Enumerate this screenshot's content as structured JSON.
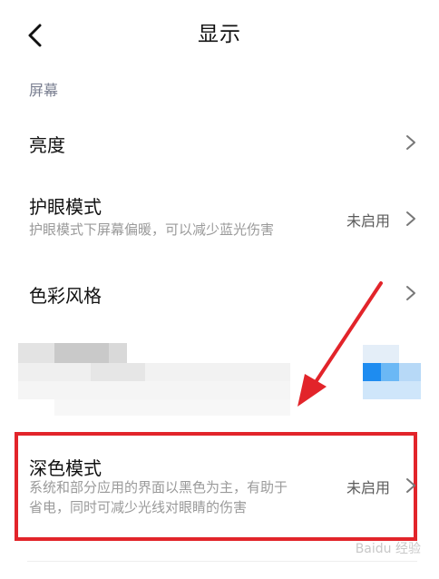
{
  "header": {
    "title": "显示"
  },
  "section": {
    "label": "屏幕"
  },
  "rows": [
    {
      "title": "亮度"
    },
    {
      "title": "护眼模式",
      "subtitle": "护眼模式下屏幕偏暖，可以减少蓝光伤害",
      "status": "未启用"
    },
    {
      "title": "色彩风格"
    },
    {
      "title": "深色模式",
      "subtitle_line1": "系统和部分应用的界面以黑色为主，有助于",
      "subtitle_line2": "省电，同时可减少光线对眼睛的伤害",
      "status": "未启用"
    }
  ],
  "watermark": "Baidu 经验",
  "colors": {
    "highlight": "#e2242a",
    "arrow": "#e2242a",
    "blur_accent": "#3aa0f0"
  }
}
